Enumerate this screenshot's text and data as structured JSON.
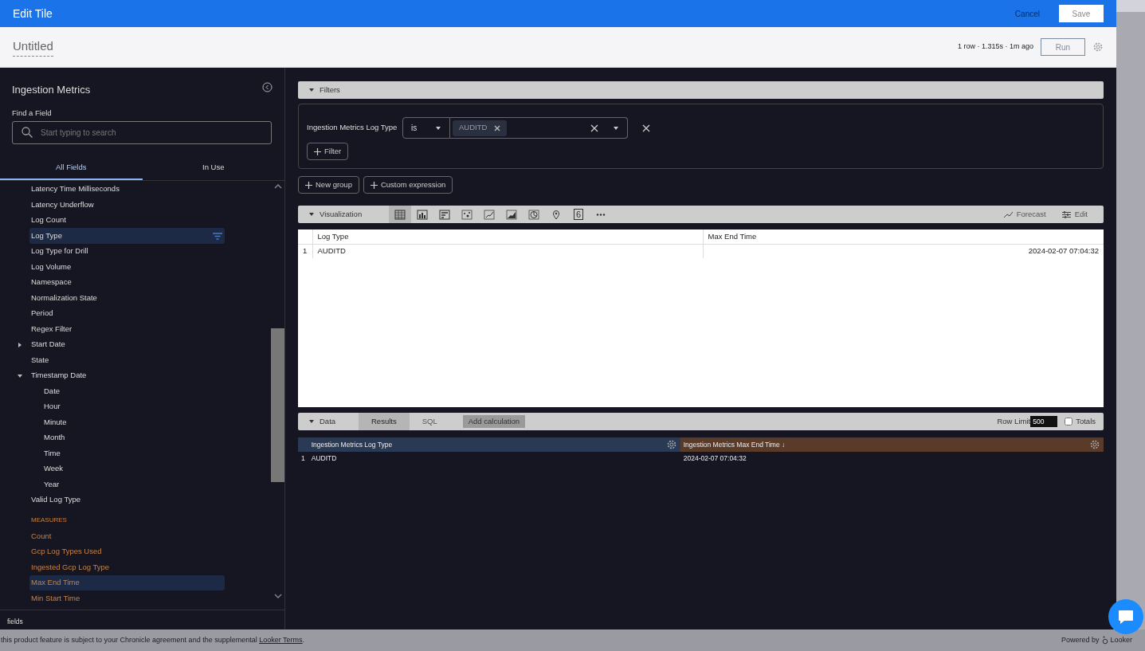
{
  "header": {
    "title": "Edit Tile",
    "cancel": "Cancel",
    "save": "Save"
  },
  "tile": {
    "name": "Untitled",
    "stats": "1 row · 1.315s · 1m ago",
    "run": "Run"
  },
  "sidebar": {
    "title": "Ingestion Metrics",
    "find_label": "Find a Field",
    "search": {
      "placeholder": "Start typing to search"
    },
    "tabs": [
      {
        "label": "All Fields",
        "selected": true
      },
      {
        "label": "In Use",
        "selected": false
      }
    ],
    "fields": [
      {
        "label": "Latency Time Milliseconds",
        "kind": "dimension",
        "selected": false
      },
      {
        "label": "Latency Underflow",
        "kind": "dimension",
        "selected": false
      },
      {
        "label": "Log Count",
        "kind": "dimension",
        "selected": false
      },
      {
        "label": "Log Type",
        "kind": "dimension",
        "selected": true,
        "filtered": true
      },
      {
        "label": "Log Type for Drill",
        "kind": "dimension",
        "selected": false
      },
      {
        "label": "Log Volume",
        "kind": "dimension",
        "selected": false
      },
      {
        "label": "Namespace",
        "kind": "dimension",
        "selected": false
      },
      {
        "label": "Normalization State",
        "kind": "dimension",
        "selected": false
      },
      {
        "label": "Period",
        "kind": "dimension",
        "selected": false
      },
      {
        "label": "Regex Filter",
        "kind": "dimension",
        "selected": false
      },
      {
        "label": "Start Date",
        "kind": "group",
        "selected": false,
        "expanded": false
      },
      {
        "label": "State",
        "kind": "dimension",
        "selected": false
      },
      {
        "label": "Timestamp Date",
        "kind": "group",
        "selected": false,
        "expanded": true,
        "children": [
          {
            "label": "Date",
            "kind": "dimension",
            "selected": false
          },
          {
            "label": "Hour",
            "kind": "dimension",
            "selected": false
          },
          {
            "label": "Minute",
            "kind": "dimension",
            "selected": false
          },
          {
            "label": "Month",
            "kind": "dimension",
            "selected": false
          },
          {
            "label": "Time",
            "kind": "dimension",
            "selected": false
          },
          {
            "label": "Week",
            "kind": "dimension",
            "selected": false
          },
          {
            "label": "Year",
            "kind": "dimension",
            "selected": false
          }
        ]
      },
      {
        "label": "Valid Log Type",
        "kind": "dimension",
        "selected": false
      },
      {
        "label": "MEASURES",
        "kind": "heading"
      },
      {
        "label": "Count",
        "kind": "measure",
        "selected": false
      },
      {
        "label": "Gcp Log Types Used",
        "kind": "measure",
        "selected": false
      },
      {
        "label": "Ingested Gcp Log Type",
        "kind": "measure",
        "selected": false
      },
      {
        "label": "Max End Time",
        "kind": "measure",
        "selected": true
      },
      {
        "label": "Min Start Time",
        "kind": "measure",
        "selected": false
      }
    ],
    "footer": "fields"
  },
  "filters": {
    "title": "Filters",
    "expanded": true,
    "field": "Ingestion Metrics Log Type",
    "operator": "is",
    "values": [
      "AUDITD"
    ],
    "add_filter": "Filter",
    "new_group": "New group",
    "custom_expression": "Custom expression"
  },
  "visualization": {
    "title": "Visualization",
    "expanded": true,
    "types": [
      {
        "kind": "table",
        "selected": true
      },
      {
        "kind": "column",
        "selected": false
      },
      {
        "kind": "bar",
        "selected": false
      },
      {
        "kind": "scatter",
        "selected": false
      },
      {
        "kind": "line",
        "selected": false
      },
      {
        "kind": "area",
        "selected": false
      },
      {
        "kind": "pie",
        "selected": false
      },
      {
        "kind": "map",
        "selected": false
      },
      {
        "kind": "single",
        "selected": false,
        "label": "6"
      },
      {
        "kind": "more",
        "selected": false
      }
    ],
    "forecast": "Forecast",
    "edit": "Edit",
    "table": {
      "columns": [
        "Log Type",
        "Max End Time"
      ],
      "rows": [
        {
          "index": "1",
          "cells": [
            "AUDITD",
            "2024-02-07 07:04:32"
          ]
        }
      ]
    }
  },
  "data": {
    "title": "Data",
    "expanded": true,
    "tabs": [
      {
        "label": "Results",
        "selected": true
      },
      {
        "label": "SQL",
        "selected": false
      }
    ],
    "add_calculation": "Add calculation",
    "row_limit_label": "Row Limit",
    "row_limit": "500",
    "totals": {
      "label": "Totals",
      "checked": false
    },
    "columns": [
      {
        "label": "Ingestion Metrics Log Type",
        "kind": "dimension"
      },
      {
        "label": "Ingestion Metrics Max End Time ↓",
        "kind": "measure"
      }
    ],
    "rows": [
      {
        "index": "1",
        "cells": [
          "AUDITD",
          "2024-02-07 07:04:32"
        ]
      }
    ]
  },
  "footer": {
    "notice": "this product feature is subject to your Chronicle agreement and the supplemental ",
    "link": "Looker Terms",
    "end": ".",
    "powered_by": "Powered by",
    "brand": "Looker"
  }
}
